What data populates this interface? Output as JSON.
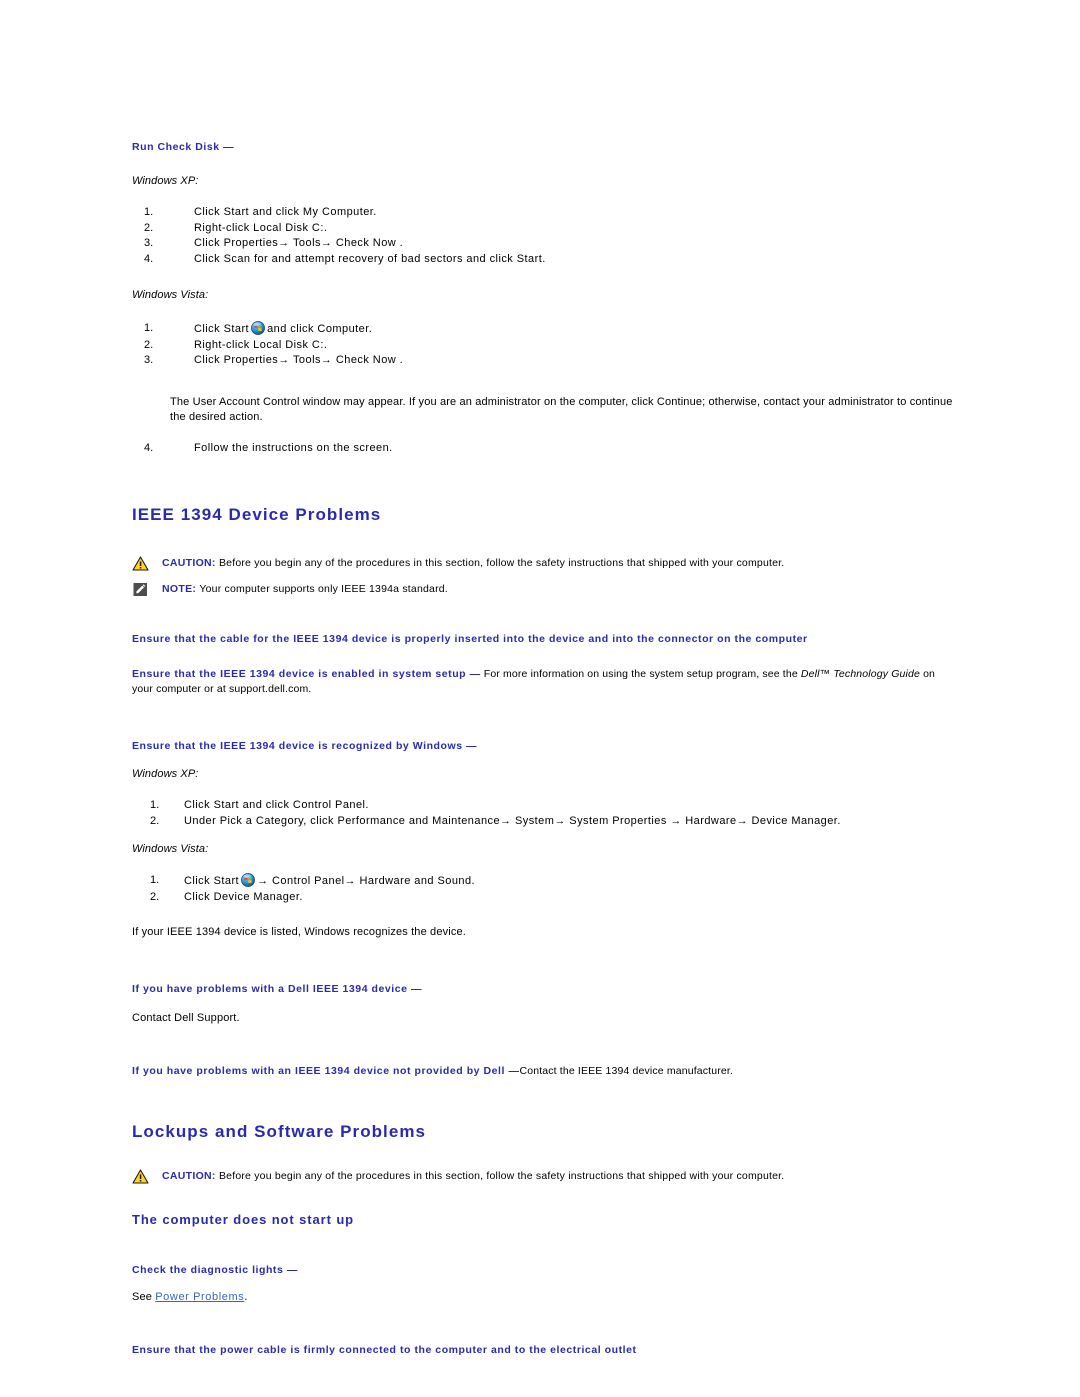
{
  "colors": {
    "heading_blue": "#2a2aaf",
    "link_blue": "#3a64c8",
    "caution_yellow": "#ffd320",
    "note_gray": "#4d4d4d",
    "body_black": "#000000"
  },
  "icons": {
    "caution": "caution-triangle-icon",
    "note": "note-pencil-icon",
    "start_orb": "windows-start-orb-icon"
  },
  "sections": {
    "run_check_disk": {
      "leadin": "Run Check Disk —",
      "xp_label": "Windows XP:",
      "xp_steps": [
        "Click Start and click My Computer.",
        "Right-click Local Disk C:.",
        "Click Properties→ Tools→ Check Now .",
        "Click Scan for and attempt recovery of bad sectors and click Start."
      ],
      "vista_label": "Windows Vista:",
      "vista_step1_pre": "Click Start",
      "vista_step1_post": "and click Computer.",
      "vista_step2": "Right-click Local Disk C:.",
      "vista_step3": "Click Properties→ Tools→ Check Now .",
      "uac_paragraph": "The User Account Control window may appear. If you are an administrator on the computer, click Continue; otherwise, contact your administrator to continue the desired action.",
      "vista_step4": "Follow the instructions on the screen."
    },
    "ieee1394": {
      "heading": "IEEE 1394 Device Problems",
      "caution": {
        "label": "CAUTION:",
        "text": "Before you begin any of the procedures in this section, follow the safety instructions that shipped with your computer."
      },
      "note": {
        "label": "NOTE:",
        "text": "Your computer supports only IEEE 1394a standard."
      },
      "check_cable": "Ensure that the cable for the IEEE 1394 device is properly inserted into the device and into the connector on the computer",
      "system_setup": {
        "leadin": "Ensure that the IEEE 1394 device is enabled in system setup —",
        "body_pre": "For more information on using the system setup program, see the",
        "body_italic": "Dell™ Technology Guide",
        "body_post": "on your computer or at support.dell.com."
      },
      "recognized": {
        "leadin": "Ensure that the IEEE 1394 device is recognized by Windows —",
        "xp_label": "Windows XP:",
        "xp_steps": [
          "Click Start and click Control Panel.",
          "Under Pick a Category, click Performance and Maintenance→ System→ System Properties → Hardware→ Device Manager."
        ],
        "vista_label": "Windows Vista:",
        "vista_step1_pre": "Click Start",
        "vista_step1_post": "→ Control Panel→ Hardware and Sound.",
        "vista_step2": "Click Device Manager.",
        "closing": "If your IEEE 1394 device is listed, Windows recognizes the device."
      },
      "dell_device": {
        "leadin": "If you have problems with a Dell IEEE 1394 device —",
        "body": "Contact Dell Support."
      },
      "non_dell_device": {
        "leadin": "If you have problems with an IEEE 1394 device not provided by Dell —",
        "body": "Contact the IEEE 1394 device manufacturer."
      }
    },
    "lockups": {
      "heading": "Lockups and Software Problems",
      "caution": {
        "label": "CAUTION:",
        "text": "Before you begin any of the procedures in this section, follow the safety instructions that shipped with your computer."
      },
      "subheading": "The computer does not start up",
      "diagnostic_lights": {
        "leadin": "Check the diagnostic lights —",
        "see_prefix": "See",
        "link_text": "Power Problems",
        "see_suffix": "."
      },
      "power_cable": "Ensure that the power cable is firmly connected to the computer and to the electrical outlet"
    }
  }
}
